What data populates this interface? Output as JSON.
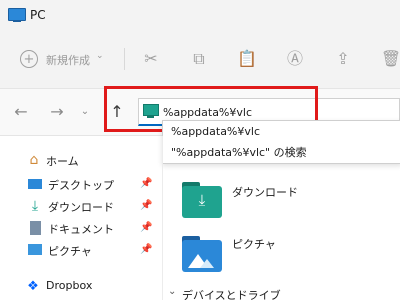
{
  "window": {
    "title": "PC"
  },
  "toolbar": {
    "new_label": "新規作成",
    "new_icon": "plus-circle-icon"
  },
  "navigation": {
    "address_value": "%appdata%¥vlc",
    "suggestions": [
      "%appdata%¥vlc",
      "\"%appdata%¥vlc\" の検索"
    ]
  },
  "sidebar": {
    "home": "ホーム",
    "quick_access": [
      {
        "label": "デスクトップ",
        "icon": "desktop-icon"
      },
      {
        "label": "ダウンロード",
        "icon": "download-icon"
      },
      {
        "label": "ドキュメント",
        "icon": "document-icon"
      },
      {
        "label": "ピクチャ",
        "icon": "pictures-icon"
      }
    ],
    "dropbox": "Dropbox"
  },
  "content": {
    "folders": [
      {
        "label": "ダウンロード",
        "icon": "download-folder-icon"
      },
      {
        "label": "ピクチャ",
        "icon": "pictures-folder-icon"
      }
    ],
    "section_label": "デバイスとドライブ"
  },
  "colors": {
    "accent": "#0067c0",
    "highlight": "#e01a1a",
    "folder_teal": "#1fa38f",
    "folder_blue": "#2b88d8"
  }
}
